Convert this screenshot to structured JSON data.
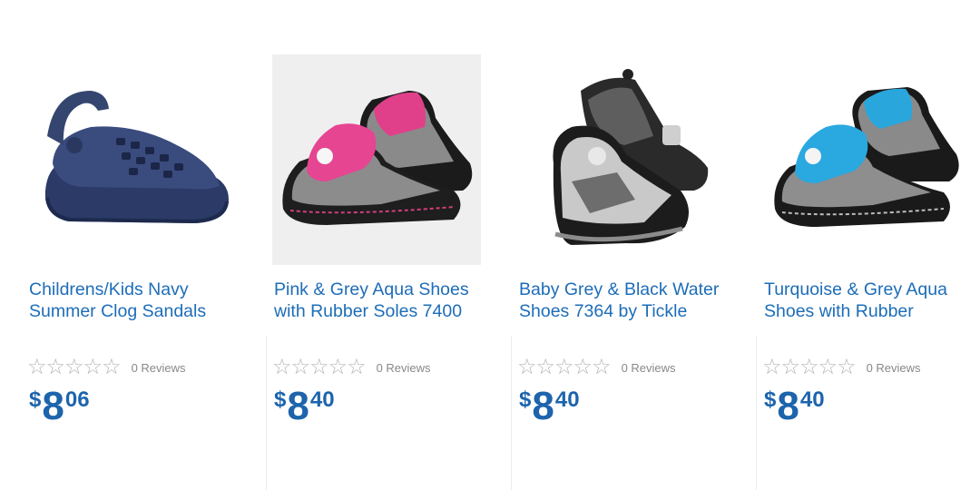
{
  "products": [
    {
      "title": "Childrens/Kids Navy Summer Clog Sandals",
      "image_icon": "navy-clog-image",
      "reviews": "0 Reviews",
      "rating": 0,
      "price": {
        "currency": "$",
        "whole": "8",
        "cents": "06"
      }
    },
    {
      "title": "Pink & Grey Aqua Shoes with Rubber Soles 7400",
      "image_icon": "pink-aqua-shoes-image",
      "reviews": "0 Reviews",
      "rating": 0,
      "price": {
        "currency": "$",
        "whole": "8",
        "cents": "40"
      }
    },
    {
      "title": "Baby Grey & Black Water Shoes 7364 by Tickle",
      "image_icon": "grey-black-water-shoes-image",
      "reviews": "0 Reviews",
      "rating": 0,
      "price": {
        "currency": "$",
        "whole": "8",
        "cents": "40"
      }
    },
    {
      "title": "Turquoise & Grey Aqua Shoes with Rubber",
      "image_icon": "turquoise-aqua-shoes-image",
      "reviews": "0 Reviews",
      "rating": 0,
      "price": {
        "currency": "$",
        "whole": "8",
        "cents": "40"
      }
    }
  ],
  "colors": {
    "link": "#1d6db8",
    "price": "#1d64ac",
    "star_empty": "#b5b5b5",
    "reviews_text": "#888888"
  }
}
